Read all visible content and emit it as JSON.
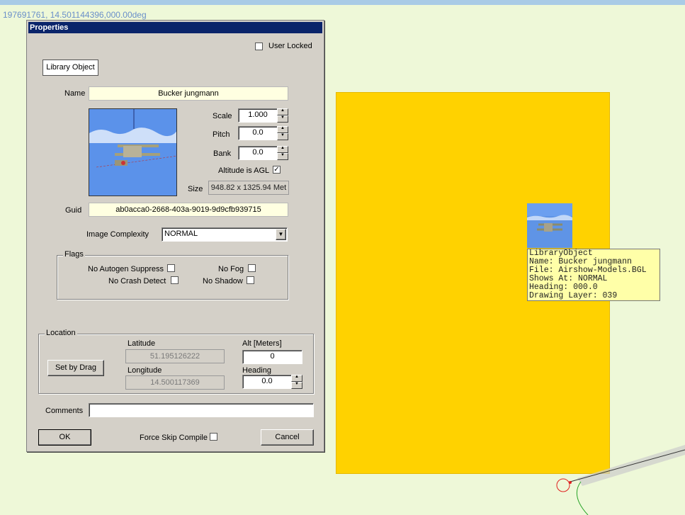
{
  "top_coordinate": "197691761, 14.501144396,000.00deg",
  "dialog": {
    "title": "Properties",
    "user_locked_label": "User Locked",
    "user_locked": false,
    "type_button": "Library Object",
    "name_label": "Name",
    "name_value": "Bucker jungmann",
    "scale_label": "Scale",
    "scale_value": "1.000",
    "pitch_label": "Pitch",
    "pitch_value": "0.0",
    "bank_label": "Bank",
    "bank_value": "0.0",
    "altitude_agl_label": "Altitude is AGL",
    "altitude_agl": true,
    "size_label": "Size",
    "size_value": "948.82 x 1325.94 Met",
    "guid_label": "Guid",
    "guid_value": "ab0acca0-2668-403a-9019-9d9cfb939715",
    "image_complexity_label": "Image Complexity",
    "image_complexity_value": "NORMAL",
    "flags": {
      "title": "Flags",
      "no_autogen_suppress": "No Autogen Suppress",
      "no_fog": "No Fog",
      "no_crash_detect": "No Crash Detect",
      "no_shadow": "No Shadow"
    },
    "location": {
      "title": "Location",
      "latitude_label": "Latitude",
      "latitude_value": "51.195126222",
      "longitude_label": "Longitude",
      "longitude_value": "14.500117369",
      "alt_label": "Alt [Meters]",
      "alt_value": "0",
      "heading_label": "Heading",
      "heading_value": "0.0",
      "set_by_drag": "Set by Drag"
    },
    "comments_label": "Comments",
    "comments_value": "",
    "ok_button": "OK",
    "force_skip_label": "Force Skip Compile",
    "cancel_button": "Cancel"
  },
  "tooltip": {
    "line1": "LibraryObject",
    "line2": "Name: Bucker jungmann",
    "line3": "File: Airshow-Models.BGL",
    "line4": "Shows At: NORMAL",
    "line5": "Heading: 000.0",
    "line6": "Drawing Layer: 039"
  },
  "colors": {
    "map_background": "#eef8d8",
    "object_area": "#ffd200",
    "titlebar": "#0a246a",
    "dialog": "#d4d0c8"
  }
}
